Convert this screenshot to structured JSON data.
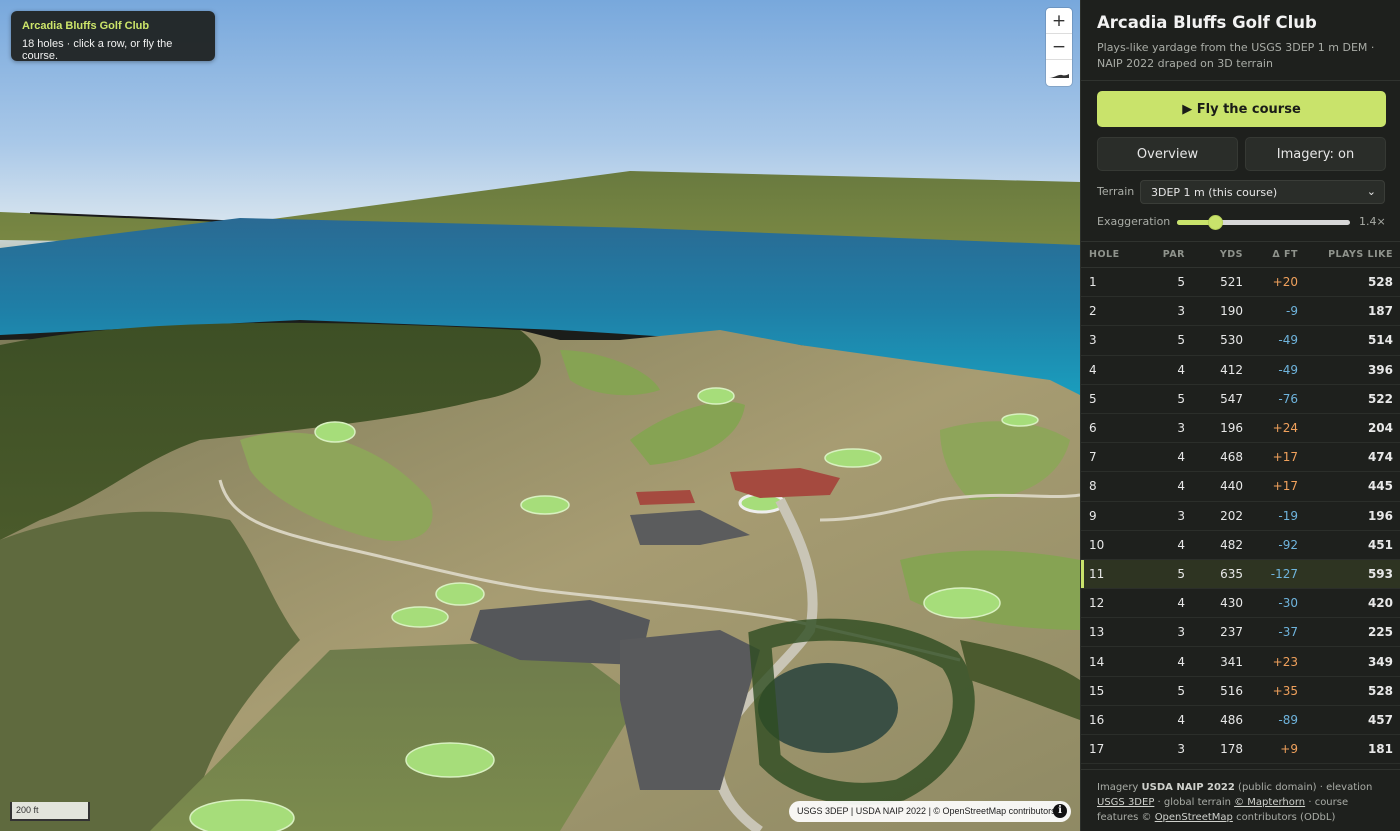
{
  "map": {
    "card_title": "Arcadia Bluffs Golf Club",
    "card_subtitle": "18 holes · click a row, or fly the course.",
    "zoom_in": "+",
    "zoom_out": "−",
    "scale_label": "200 ft",
    "attribution": "USGS 3DEP | USDA NAIP 2022 | © OpenStreetMap contributors",
    "info_glyph": "i"
  },
  "panel": {
    "title": "Arcadia Bluffs Golf Club",
    "subtitle": "Plays-like yardage from the USGS 3DEP 1 m DEM · NAIP 2022 draped on 3D terrain",
    "fly_label": "▶ Fly the course",
    "overview_label": "Overview",
    "imagery_label": "Imagery: on",
    "terrain_label": "Terrain",
    "terrain_value": "3DEP 1 m (this course)",
    "exaggeration_label": "Exaggeration",
    "exaggeration_value": "1.4×",
    "exaggeration_fraction": 0.22,
    "accent_color": "#c9e36b"
  },
  "table": {
    "headers": {
      "hole": "HOLE",
      "par": "PAR",
      "yds": "YDS",
      "dft": "Δ FT",
      "plays": "PLAYS LIKE"
    },
    "active_hole": "11",
    "rows": [
      {
        "hole": "1",
        "par": "5",
        "yds": "521",
        "dft": "+20",
        "plays": "528"
      },
      {
        "hole": "2",
        "par": "3",
        "yds": "190",
        "dft": "-9",
        "plays": "187"
      },
      {
        "hole": "3",
        "par": "5",
        "yds": "530",
        "dft": "-49",
        "plays": "514"
      },
      {
        "hole": "4",
        "par": "4",
        "yds": "412",
        "dft": "-49",
        "plays": "396"
      },
      {
        "hole": "5",
        "par": "5",
        "yds": "547",
        "dft": "-76",
        "plays": "522"
      },
      {
        "hole": "6",
        "par": "3",
        "yds": "196",
        "dft": "+24",
        "plays": "204"
      },
      {
        "hole": "7",
        "par": "4",
        "yds": "468",
        "dft": "+17",
        "plays": "474"
      },
      {
        "hole": "8",
        "par": "4",
        "yds": "440",
        "dft": "+17",
        "plays": "445"
      },
      {
        "hole": "9",
        "par": "3",
        "yds": "202",
        "dft": "-19",
        "plays": "196"
      },
      {
        "hole": "10",
        "par": "4",
        "yds": "482",
        "dft": "-92",
        "plays": "451"
      },
      {
        "hole": "11",
        "par": "5",
        "yds": "635",
        "dft": "-127",
        "plays": "593"
      },
      {
        "hole": "12",
        "par": "4",
        "yds": "430",
        "dft": "-30",
        "plays": "420"
      },
      {
        "hole": "13",
        "par": "3",
        "yds": "237",
        "dft": "-37",
        "plays": "225"
      },
      {
        "hole": "14",
        "par": "4",
        "yds": "341",
        "dft": "+23",
        "plays": "349"
      },
      {
        "hole": "15",
        "par": "5",
        "yds": "516",
        "dft": "+35",
        "plays": "528"
      },
      {
        "hole": "16",
        "par": "4",
        "yds": "486",
        "dft": "-89",
        "plays": "457"
      },
      {
        "hole": "17",
        "par": "3",
        "yds": "178",
        "dft": "+9",
        "plays": "181"
      }
    ]
  },
  "footer": {
    "imagery_prefix": "Imagery ",
    "imagery_source": "USDA NAIP 2022",
    "imagery_mid": " (public domain) · elevation ",
    "elevation_source": "USGS 3DEP",
    "global_mid": " · global terrain ",
    "global_source": "© Mapterhorn",
    "features_mid": " · course features ",
    "osm_prefix": "© ",
    "osm_source": "OpenStreetMap",
    "osm_suffix": " contributors (ODbL)"
  }
}
